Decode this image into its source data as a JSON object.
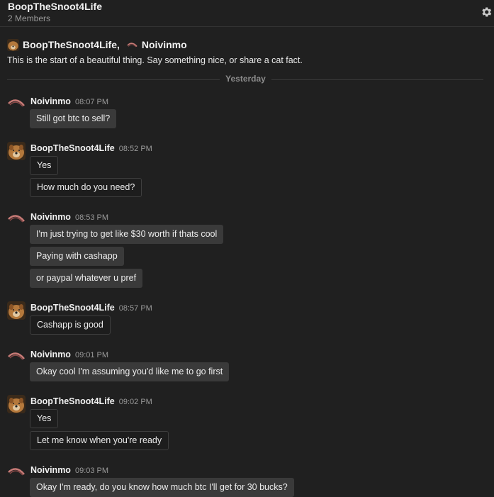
{
  "header": {
    "title": "BoopTheSnoot4Life",
    "member_count": "2 Members",
    "settings_icon": "gear-icon"
  },
  "intro": {
    "user1": "BoopTheSnoot4Life,",
    "user2": "Noivinmo",
    "text": "This is the start of a beautiful thing. Say something nice, or share a cat fact."
  },
  "divider": {
    "label": "Yesterday"
  },
  "groups": [
    {
      "author": "Noivinmo",
      "time": "08:07 PM",
      "messages": [
        "Still got btc to sell?"
      ]
    },
    {
      "author": "BoopTheSnoot4Life",
      "time": "08:52 PM",
      "messages": [
        "Yes",
        "How much do you need?"
      ]
    },
    {
      "author": "Noivinmo",
      "time": "08:53 PM",
      "messages": [
        "I'm just trying to get like $30 worth if thats cool",
        "Paying with cashapp",
        "or paypal whatever u pref"
      ]
    },
    {
      "author": "BoopTheSnoot4Life",
      "time": "08:57 PM",
      "messages": [
        "Cashapp is good"
      ]
    },
    {
      "author": "Noivinmo",
      "time": "09:01 PM",
      "messages": [
        "Okay cool I'm assuming you'd like me to go first"
      ]
    },
    {
      "author": "BoopTheSnoot4Life",
      "time": "09:02 PM",
      "messages": [
        "Yes",
        "Let me know when you're ready"
      ]
    },
    {
      "author": "Noivinmo",
      "time": "09:03 PM",
      "messages": [
        "Okay I'm ready, do you know how much btc I'll get for 30 bucks?"
      ]
    }
  ],
  "colors": {
    "background": "#202020",
    "incoming_bubble": "#3a3a3a",
    "outgoing_bubble": "#1d1d1d"
  }
}
